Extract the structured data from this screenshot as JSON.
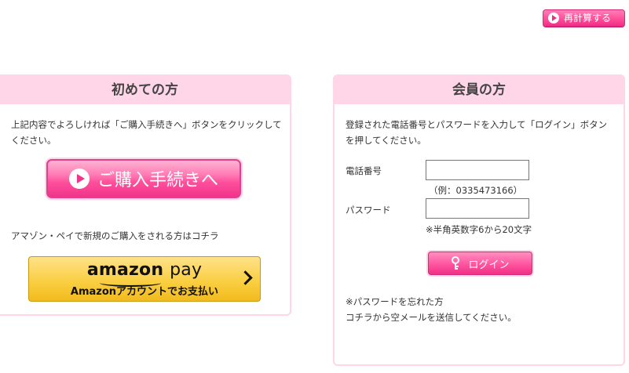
{
  "recalc_button": {
    "label": "再計算する",
    "icon": "play-circle-icon"
  },
  "first_time": {
    "heading": "初めての方",
    "intro": "上記内容でよろしければ「ご購入手続きへ」ボタンをクリックしてください。",
    "purchase_button": "ご購入手続きへ",
    "amazon_note": "アマゾン・ペイで新規のご購入をされる方はコチラ",
    "amazon_pay": {
      "brand": "amazon",
      "pay": "pay",
      "sub_label": "Amazonアカウントでお支払い"
    }
  },
  "member": {
    "heading": "会員の方",
    "intro": "登録された電話番号とパスワードを入力して「ログイン」ボタンを押してください。",
    "phone_label": "電話番号",
    "phone_value": "",
    "phone_hint": "（例：0335473166）",
    "password_label": "パスワード",
    "password_value": "",
    "password_hint": "※半角英数字6から20文字",
    "login_button": "ログイン",
    "forgot_line1": "※パスワードを忘れた方",
    "forgot_line2": "コチラから空メールを送信してください。"
  },
  "colors": {
    "accent_pink": "#ef2f86",
    "panel_header": "#ffd6e7",
    "amazon_yellow": "#f9cd3d"
  }
}
